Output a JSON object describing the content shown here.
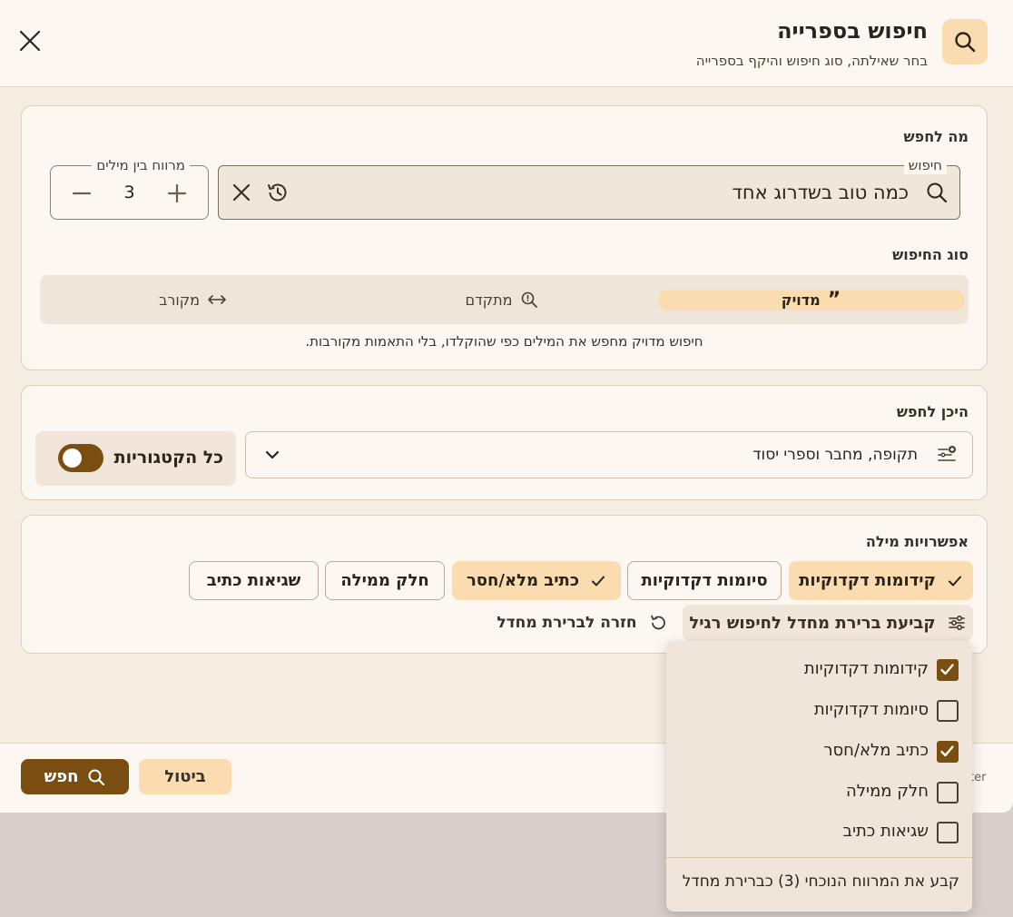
{
  "header": {
    "title": "חיפוש בספרייה",
    "subtitle": "בחר שאילתה, סוג חיפוש והיקף בספרייה",
    "icon": "search-icon",
    "close_icon": "close-icon"
  },
  "what_section": {
    "label": "מה לחפש",
    "search_field": {
      "label": "חיפוש",
      "value": "כמה טוב בשדרוג אחד"
    },
    "spacing_field": {
      "label": "מרווח בין מילים",
      "value": "3"
    }
  },
  "search_type": {
    "label": "סוג החיפוש",
    "options": [
      {
        "label": "מדויק",
        "icon": "quote-icon",
        "active": true
      },
      {
        "label": "מתקדם",
        "icon": "search-icon",
        "active": false
      },
      {
        "label": "מקורב",
        "icon": "arrows-horizontal-icon",
        "active": false
      }
    ],
    "description": "חיפוש מדויק מחפש את המילים כפי שהוקלדו, בלי התאמות מקורבות."
  },
  "where_section": {
    "label": "היכן לחפש",
    "category_text": "תקופה, מחבר וספרי יסוד",
    "all_categories_label": "כל הקטגוריות",
    "all_categories_enabled": false
  },
  "word_options": {
    "label": "אפשרויות מילה",
    "chips": [
      {
        "label": "קידומות דקדוקיות",
        "selected": true
      },
      {
        "label": "סיומות דקדוקיות",
        "selected": false
      },
      {
        "label": "כתיב מלא/חסר",
        "selected": true
      },
      {
        "label": "חלק ממילה",
        "selected": false
      },
      {
        "label": "שגיאות כתיב",
        "selected": false
      }
    ],
    "set_default_label": "קביעת ברירת מחדל לחיפוש רגיל",
    "reset_default_label": "חזרה לברירת מחדל"
  },
  "footer": {
    "search_button": "חפש",
    "cancel_button": "ביטול",
    "truncated_text": "ter"
  },
  "defaults_menu": {
    "items": [
      {
        "label": "קידומות דקדוקיות",
        "checked": true
      },
      {
        "label": "סיומות דקדוקיות",
        "checked": false
      },
      {
        "label": "כתיב מלא/חסר",
        "checked": true
      },
      {
        "label": "חלק ממילה",
        "checked": false
      },
      {
        "label": "שגיאות כתיב",
        "checked": false
      }
    ],
    "action": "קבע את המרווח הנוכחי (3) כברירת מחדל"
  },
  "colors": {
    "accent": "#7a4e11",
    "accent_light": "#fbdcb0",
    "surface": "#fdf7f2",
    "background": "#f5ece2"
  }
}
